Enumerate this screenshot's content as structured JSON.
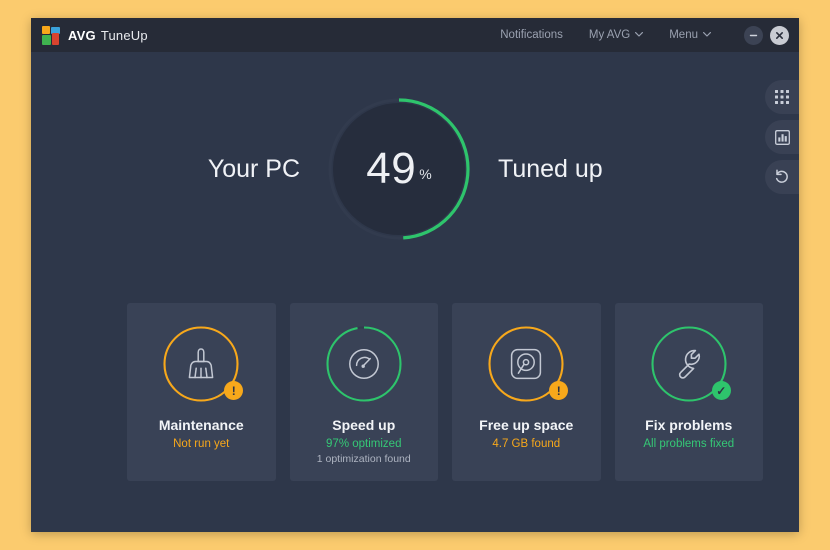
{
  "colors": {
    "page_backdrop": "#fbcb6e",
    "window_bg": "#2e374a",
    "titlebar_bg": "#262b37",
    "card_bg": "#394256",
    "gauge_inner": "#262d3d",
    "track": "#323b4e",
    "green": "#2ec46c",
    "orange": "#f7a81b",
    "text_primary": "#f0f2f6",
    "text_muted": "#9aa1b0"
  },
  "titlebar": {
    "logo_icon": "avg-logo-icon",
    "brand": "AVG",
    "product": "TuneUp",
    "notifications_label": "Notifications",
    "my_avg_label": "My AVG",
    "menu_label": "Menu",
    "caret": "⌄",
    "minimize_icon": "minimize-icon",
    "close_icon": "close-icon"
  },
  "rail": {
    "items": [
      {
        "name": "all-tools",
        "icon": "grid-icon"
      },
      {
        "name": "reports",
        "icon": "bar-chart-icon"
      },
      {
        "name": "rescue-center",
        "icon": "undo-icon"
      }
    ]
  },
  "hero": {
    "left_label": "Your PC",
    "right_label": "Tuned up",
    "gauge_value": "49",
    "gauge_unit": "%",
    "gauge_percent": 49
  },
  "cards": [
    {
      "id": "maintenance",
      "title": "Maintenance",
      "status": "Not run yet",
      "status_tone": "warn",
      "note": "",
      "icon": "broom-icon",
      "ring_percent": 100,
      "ring_color": "#f7a81b",
      "badge": "warning",
      "badge_glyph": "!"
    },
    {
      "id": "speed-up",
      "title": "Speed up",
      "status": "97% optimized",
      "status_tone": "ok",
      "note": "1 optimization found",
      "icon": "speedometer-icon",
      "ring_percent": 97,
      "ring_color": "#2ec46c",
      "badge": "none",
      "badge_glyph": ""
    },
    {
      "id": "free-up-space",
      "title": "Free up space",
      "status": "4.7 GB found",
      "status_tone": "warn",
      "note": "",
      "icon": "hard-disk-icon",
      "ring_percent": 100,
      "ring_color": "#f7a81b",
      "badge": "warning",
      "badge_glyph": "!"
    },
    {
      "id": "fix-problems",
      "title": "Fix problems",
      "status": "All problems fixed",
      "status_tone": "ok",
      "note": "",
      "icon": "wrench-icon",
      "ring_percent": 100,
      "ring_color": "#2ec46c",
      "badge": "ok",
      "badge_glyph": "✓"
    }
  ]
}
